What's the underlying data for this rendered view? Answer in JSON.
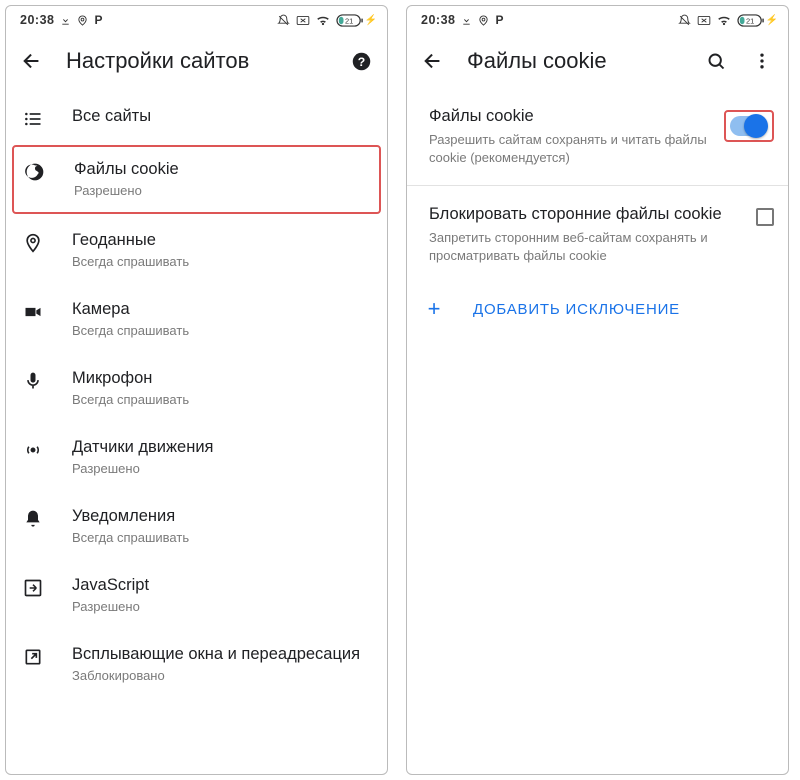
{
  "status": {
    "time": "20:38",
    "battery": "21"
  },
  "left": {
    "title": "Настройки сайтов",
    "items": [
      {
        "title": "Все сайты",
        "sub": ""
      },
      {
        "title": "Файлы cookie",
        "sub": "Разрешено"
      },
      {
        "title": "Геоданные",
        "sub": "Всегда спрашивать"
      },
      {
        "title": "Камера",
        "sub": "Всегда спрашивать"
      },
      {
        "title": "Микрофон",
        "sub": "Всегда спрашивать"
      },
      {
        "title": "Датчики движения",
        "sub": "Разрешено"
      },
      {
        "title": "Уведомления",
        "sub": "Всегда спрашивать"
      },
      {
        "title": "JavaScript",
        "sub": "Разрешено"
      },
      {
        "title": "Всплывающие окна и переадресация",
        "sub": "Заблокировано"
      }
    ]
  },
  "right": {
    "title": "Файлы cookie",
    "cookies": {
      "title": "Файлы cookie",
      "sub": "Разрешить сайтам сохранять и читать файлы cookie (рекомендуется)"
    },
    "block": {
      "title": "Блокировать сторонние файлы cookie",
      "sub": "Запретить сторонним веб-сайтам сохранять и просматривать файлы cookie"
    },
    "add": "ДОБАВИТЬ ИСКЛЮЧЕНИЕ"
  }
}
